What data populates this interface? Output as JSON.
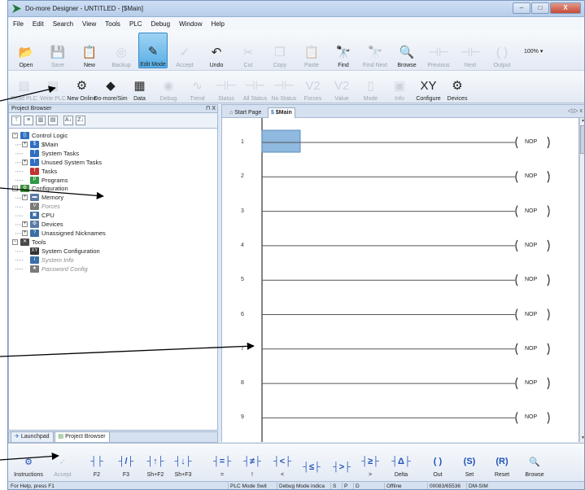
{
  "window": {
    "title": "Do-more Designer - UNTITLED - [$Main]",
    "controls": {
      "minimize": "–",
      "maximize": "□",
      "close": "X"
    }
  },
  "menu": [
    "File",
    "Edit",
    "Search",
    "View",
    "Tools",
    "PLC",
    "Debug",
    "Window",
    "Help"
  ],
  "toolbar1": [
    {
      "label": "Open",
      "icon": "folder-open-icon",
      "glyph": "📂",
      "enabled": true
    },
    {
      "label": "Save",
      "icon": "save-icon",
      "glyph": "💾",
      "enabled": false
    },
    {
      "label": "New",
      "icon": "new-project-icon",
      "glyph": "📋",
      "enabled": true
    },
    {
      "label": "Backup",
      "icon": "backup-icon",
      "glyph": "◎",
      "enabled": false
    },
    {
      "label": "Edit Mode",
      "icon": "edit-mode-icon",
      "glyph": "✎",
      "enabled": true,
      "selected": true
    },
    {
      "label": "Accept",
      "icon": "accept-icon",
      "glyph": "✓",
      "enabled": false
    },
    {
      "label": "Undo",
      "icon": "undo-icon",
      "glyph": "↶",
      "enabled": true
    },
    {
      "label": "Cut",
      "icon": "cut-icon",
      "glyph": "✂",
      "enabled": false
    },
    {
      "label": "Copy",
      "icon": "copy-icon",
      "glyph": "❐",
      "enabled": false
    },
    {
      "label": "Paste",
      "icon": "paste-icon",
      "glyph": "📋",
      "enabled": false
    },
    {
      "label": "Find",
      "icon": "find-icon",
      "glyph": "🔭",
      "enabled": true
    },
    {
      "label": "Find Next",
      "icon": "find-next-icon",
      "glyph": "🔭",
      "enabled": false
    },
    {
      "label": "Browse",
      "icon": "browse-icon",
      "glyph": "🔍",
      "enabled": true
    },
    {
      "label": "Previous",
      "icon": "previous-icon",
      "glyph": "⊣⊢",
      "enabled": false
    },
    {
      "label": "Next",
      "icon": "next-icon",
      "glyph": "⊣⊢",
      "enabled": false
    },
    {
      "label": "Output",
      "icon": "output-icon",
      "glyph": "( )",
      "enabled": false
    }
  ],
  "zoom": "100%",
  "toolbar2": [
    {
      "label": "Read PLC",
      "icon": "read-plc-icon",
      "glyph": "▤",
      "enabled": false
    },
    {
      "label": "Write PLC",
      "icon": "write-plc-icon",
      "glyph": "▤",
      "enabled": false
    },
    {
      "label": "New Online",
      "icon": "new-online-icon",
      "glyph": "⚙",
      "enabled": true
    },
    {
      "label": "Do-more/Sim",
      "icon": "simulator-icon",
      "glyph": "◆",
      "enabled": true
    },
    {
      "label": "Data",
      "icon": "data-view-icon",
      "glyph": "▦",
      "enabled": true
    },
    {
      "label": "Debug",
      "icon": "debug-icon",
      "glyph": "◉",
      "enabled": false
    },
    {
      "label": "Trend",
      "icon": "trend-icon",
      "glyph": "∿",
      "enabled": false
    },
    {
      "label": "Status",
      "icon": "status-icon",
      "glyph": "⊣⊢",
      "enabled": false
    },
    {
      "label": "All Status",
      "icon": "all-status-icon",
      "glyph": "⊣⊢",
      "enabled": false
    },
    {
      "label": "No Status",
      "icon": "no-status-icon",
      "glyph": "⊣⊢",
      "enabled": false
    },
    {
      "label": "Forces",
      "icon": "forces-icon",
      "glyph": "V2",
      "enabled": false
    },
    {
      "label": "Value",
      "icon": "value-icon",
      "glyph": "V2",
      "enabled": false
    },
    {
      "label": "Mode",
      "icon": "mode-icon",
      "glyph": "▯",
      "enabled": false
    },
    {
      "label": "Info",
      "icon": "info-icon",
      "glyph": "▣",
      "enabled": false
    },
    {
      "label": "Configure",
      "icon": "configure-icon",
      "glyph": "XY",
      "enabled": true
    },
    {
      "label": "Devices",
      "icon": "devices-icon",
      "glyph": "⚙",
      "enabled": true
    }
  ],
  "project_browser": {
    "title": "Project Browser",
    "pin": "⊓ X",
    "tree": [
      {
        "label": "Control Logic",
        "level": 0,
        "exp": "−",
        "icon": "control-logic-icon",
        "glyph": "()",
        "color": "#2f6fc2"
      },
      {
        "label": "$Main",
        "level": 1,
        "exp": "+",
        "icon": "main-program-icon",
        "glyph": "$",
        "color": "#2f6fc2"
      },
      {
        "label": "System Tasks",
        "level": 1,
        "exp": "",
        "icon": "system-tasks-icon",
        "glyph": "T",
        "color": "#2f6fc2"
      },
      {
        "label": "Unused System Tasks",
        "level": 1,
        "exp": "+",
        "icon": "unused-tasks-icon",
        "glyph": "T",
        "color": "#2f6fc2"
      },
      {
        "label": "Tasks",
        "level": 1,
        "exp": "",
        "icon": "tasks-icon",
        "glyph": "T",
        "color": "#c2342f"
      },
      {
        "label": "Programs",
        "level": 1,
        "exp": "",
        "icon": "programs-icon",
        "glyph": "P",
        "color": "#2f9a44"
      },
      {
        "label": "Configuration",
        "level": 0,
        "exp": "−",
        "icon": "configuration-icon",
        "glyph": "⚙",
        "color": "#3c8f3c"
      },
      {
        "label": "Memory",
        "level": 1,
        "exp": "+",
        "icon": "memory-icon",
        "glyph": "▬",
        "color": "#5a79a8"
      },
      {
        "label": "Forces",
        "level": 1,
        "exp": "",
        "icon": "forces-tree-icon",
        "glyph": "V",
        "color": "#7a7a7a",
        "gray": true
      },
      {
        "label": "CPU",
        "level": 1,
        "exp": "",
        "icon": "cpu-icon",
        "glyph": "▣",
        "color": "#3a6ea5"
      },
      {
        "label": "Devices",
        "level": 1,
        "exp": "+",
        "icon": "devices-tree-icon",
        "glyph": "⚙",
        "color": "#5a79a8"
      },
      {
        "label": "Unassigned Nicknames",
        "level": 1,
        "exp": "+",
        "icon": "nicknames-icon",
        "glyph": "?",
        "color": "#3a6ea5"
      },
      {
        "label": "Tools",
        "level": 0,
        "exp": "−",
        "icon": "tools-icon",
        "glyph": "✕",
        "color": "#4a4a4a"
      },
      {
        "label": "System Configuration",
        "level": 1,
        "exp": "",
        "icon": "system-config-icon",
        "glyph": "XY",
        "color": "#333333"
      },
      {
        "label": "System Info",
        "level": 1,
        "exp": "",
        "icon": "system-info-icon",
        "glyph": "i",
        "color": "#3a6ea5",
        "gray": true
      },
      {
        "label": "Password Config",
        "level": 1,
        "exp": "",
        "icon": "password-config-icon",
        "glyph": "★",
        "color": "#7a7a7a",
        "gray": true
      }
    ],
    "tabs": [
      {
        "label": "Launchpad",
        "icon": "launchpad-icon",
        "active": false
      },
      {
        "label": "Project Browser",
        "icon": "project-browser-icon",
        "active": true
      }
    ]
  },
  "editor": {
    "tabs": [
      {
        "label": "Start Page",
        "icon": "start-page-icon",
        "active": false
      },
      {
        "label": "$Main",
        "icon": "main-program-icon",
        "active": true
      }
    ],
    "tab_nav": "◁ ▷ x",
    "rungs": [
      {
        "number": "1",
        "output": "NOP"
      },
      {
        "number": "2",
        "output": "NOP"
      },
      {
        "number": "3",
        "output": "NOP"
      },
      {
        "number": "4",
        "output": "NOP"
      },
      {
        "number": "5",
        "output": "NOP"
      },
      {
        "number": "6",
        "output": "NOP"
      },
      {
        "number": "7",
        "output": "NOP"
      },
      {
        "number": "8",
        "output": "NOP"
      },
      {
        "number": "9",
        "output": "NOP"
      }
    ]
  },
  "instruction_toolbar": [
    {
      "label": "Instructions",
      "icon": "instructions-icon",
      "glyph": "⚙",
      "enabled": true
    },
    {
      "label": "Accept",
      "icon": "accept-edit-icon",
      "glyph": "✓",
      "enabled": false
    },
    {
      "label": "F2",
      "icon": "contact-no-icon",
      "glyph": "┤├",
      "enabled": true
    },
    {
      "label": "F3",
      "icon": "contact-nc-icon",
      "glyph": "┤/├",
      "enabled": true
    },
    {
      "label": "Sh+F2",
      "icon": "contact-rising-icon",
      "glyph": "┤↑├",
      "enabled": true
    },
    {
      "label": "Sh+F3",
      "icon": "contact-falling-icon",
      "glyph": "┤↓├",
      "enabled": true
    },
    {
      "label": "=",
      "icon": "compare-equal-icon",
      "glyph": "┤=├",
      "enabled": true
    },
    {
      "label": "!",
      "icon": "compare-not-equal-icon",
      "glyph": "┤≠├",
      "enabled": true
    },
    {
      "label": "<",
      "icon": "compare-less-icon",
      "glyph": "┤<├",
      "enabled": true
    },
    {
      "label": "",
      "icon": "compare-less-equal-icon",
      "glyph": "┤≤├",
      "enabled": true
    },
    {
      "label": "",
      "icon": "compare-greater-icon",
      "glyph": "┤>├",
      "enabled": true
    },
    {
      "label": ">",
      "icon": "compare-greater-equal-icon",
      "glyph": "┤≥├",
      "enabled": true
    },
    {
      "label": "Delta",
      "icon": "delta-icon",
      "glyph": "┤Δ├",
      "enabled": true
    },
    {
      "label": "Out",
      "icon": "coil-out-icon",
      "glyph": "( )",
      "enabled": true
    },
    {
      "label": "Set",
      "icon": "coil-set-icon",
      "glyph": "(S)",
      "enabled": true
    },
    {
      "label": "Reset",
      "icon": "coil-reset-icon",
      "glyph": "(R)",
      "enabled": true
    },
    {
      "label": "Browse",
      "icon": "browse-instruction-icon",
      "glyph": "🔍",
      "enabled": true
    }
  ],
  "status": {
    "help": "For Help, press F1",
    "mode": "PLC Mode Swit",
    "debug": "Debug Mode indica",
    "s": "S",
    "p": "P",
    "d": "D",
    "online": "Offline",
    "memory": "00083/65536",
    "plc": "DM-SIM"
  },
  "colors": {
    "accent": "#56aee6",
    "arrow": "#000000"
  }
}
